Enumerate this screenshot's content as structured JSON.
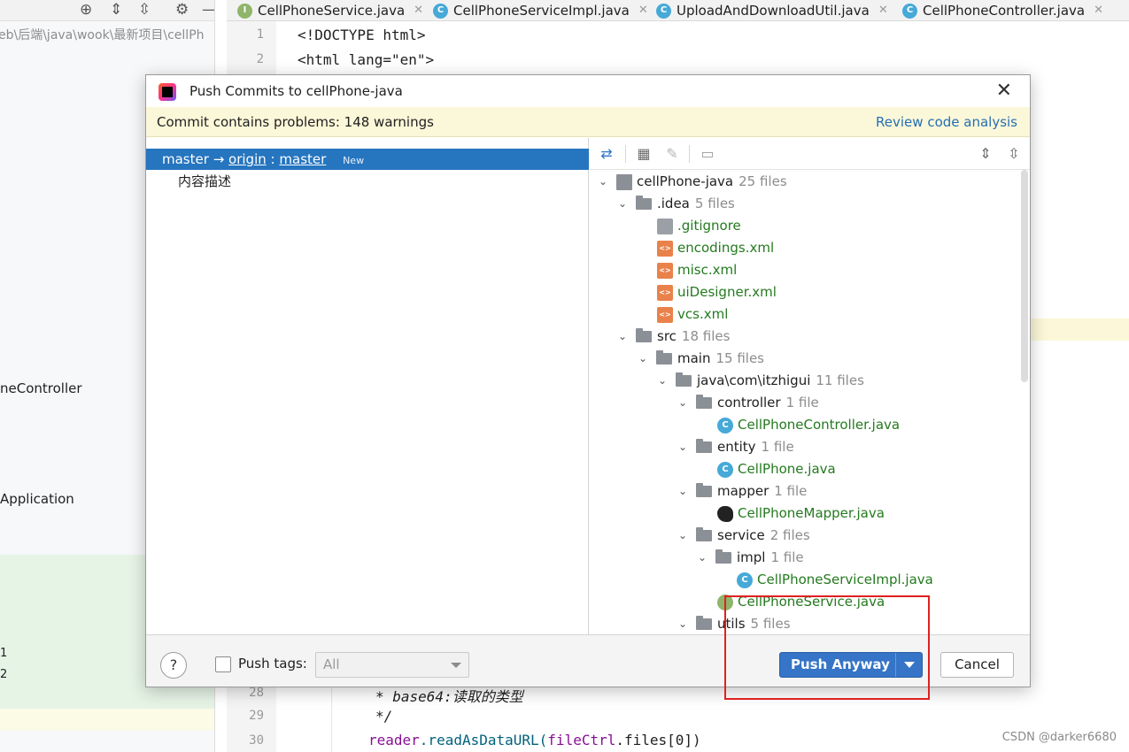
{
  "ide": {
    "path": "eb\\后端\\java\\wook\\最新项目\\cellPh",
    "side_labels": [
      "neController",
      "Application",
      "1",
      "2"
    ],
    "tabs": [
      {
        "label": "CellPhoneService.java",
        "icon": "interface-icon"
      },
      {
        "label": "CellPhoneServiceImpl.java",
        "icon": "class-icon"
      },
      {
        "label": "UploadAndDownloadUtil.java",
        "icon": "class-icon"
      },
      {
        "label": "CellPhoneController.java",
        "icon": "class-icon"
      }
    ],
    "line_numbers": {
      "l1": "1",
      "l2": "2",
      "l28": "28",
      "l29": "29",
      "l30": "30"
    },
    "code": {
      "doctype": "<!DOCTYPE html>",
      "html_open": "<html lang=\"en\">",
      "comment1": "* base64:读取的类型",
      "comment2": "*/",
      "reader_obj": "reader",
      "reader_fn": ".readAsDataURL(",
      "reader_arg": "fileCtrl",
      "reader_tail": ".files[0])"
    }
  },
  "watermark": "CSDN @darker6680",
  "dialog": {
    "title": "Push Commits to cellPhone-java",
    "banner": {
      "message": "Commit contains problems: 148 warnings",
      "link": "Review code analysis"
    },
    "branch": {
      "local": "master",
      "arrow": "→",
      "remote": "origin",
      "sep": ":",
      "remote_branch": "master",
      "badge": "New"
    },
    "commit_message": "内容描述",
    "tree": [
      {
        "name": "cellPhone-java",
        "count": "25 files",
        "type": "module"
      },
      {
        "name": ".idea",
        "count": "5 files",
        "type": "folder"
      },
      {
        "name": ".gitignore",
        "type": "git"
      },
      {
        "name": "encodings.xml",
        "type": "xml"
      },
      {
        "name": "misc.xml",
        "type": "xml"
      },
      {
        "name": "uiDesigner.xml",
        "type": "xml"
      },
      {
        "name": "vcs.xml",
        "type": "xml"
      },
      {
        "name": "src",
        "count": "18 files",
        "type": "folder"
      },
      {
        "name": "main",
        "count": "15 files",
        "type": "folder"
      },
      {
        "name": "java\\com\\itzhigui",
        "count": "11 files",
        "type": "folder"
      },
      {
        "name": "controller",
        "count": "1 file",
        "type": "folder"
      },
      {
        "name": "CellPhoneController.java",
        "type": "class"
      },
      {
        "name": "entity",
        "count": "1 file",
        "type": "folder"
      },
      {
        "name": "CellPhone.java",
        "type": "class"
      },
      {
        "name": "mapper",
        "count": "1 file",
        "type": "folder"
      },
      {
        "name": "CellPhoneMapper.java",
        "type": "mybatis"
      },
      {
        "name": "service",
        "count": "2 files",
        "type": "folder"
      },
      {
        "name": "impl",
        "count": "1 file",
        "type": "folder"
      },
      {
        "name": "CellPhoneServiceImpl.java",
        "type": "class"
      },
      {
        "name": "CellPhoneService.java",
        "type": "interface"
      },
      {
        "name": "utils",
        "count": "5 files",
        "type": "folder"
      }
    ],
    "footer": {
      "help": "?",
      "push_tags_label": "Push tags:",
      "tags_value": "All",
      "push_button": "Push Anyway",
      "cancel_button": "Cancel"
    }
  },
  "colors": {
    "accent": "#3574c6",
    "selection": "#2675bf",
    "warning_banner": "#fbf7d9",
    "added_file": "#247a1f",
    "annotation_box": "#e02020"
  }
}
